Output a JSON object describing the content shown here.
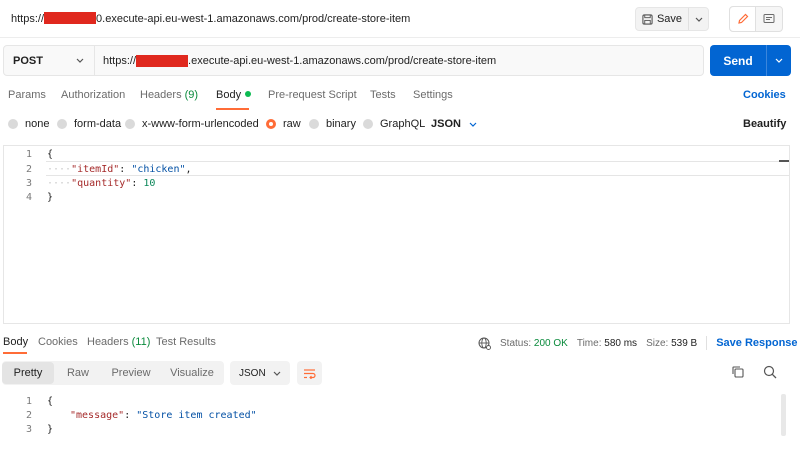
{
  "top": {
    "title_prefix": "https://",
    "title_suffix": "0.execute-api.eu-west-1.amazonaws.com/prod/create-store-item",
    "save_label": "Save"
  },
  "request": {
    "method": "POST",
    "url_prefix": "https://",
    "url_suffix": ".execute-api.eu-west-1.amazonaws.com/prod/create-store-item",
    "send_label": "Send"
  },
  "req_tabs": {
    "params": "Params",
    "authorization": "Authorization",
    "headers": "Headers",
    "headers_count": "(9)",
    "body": "Body",
    "prerequest": "Pre-request Script",
    "tests": "Tests",
    "settings": "Settings",
    "cookies_link": "Cookies"
  },
  "body_types": {
    "none": "none",
    "form_data": "form-data",
    "urlencoded": "x-www-form-urlencoded",
    "raw": "raw",
    "binary": "binary",
    "graphql": "GraphQL",
    "format": "JSON",
    "beautify": "Beautify"
  },
  "request_body": {
    "line_numbers": [
      "1",
      "2",
      "3",
      "4"
    ],
    "open_brace": "{",
    "close_brace": "}",
    "key1": "\"itemId\"",
    "val1": "\"chicken\"",
    "key2": "\"quantity\"",
    "val2": "10"
  },
  "resp_tabs": {
    "body": "Body",
    "cookies": "Cookies",
    "headers": "Headers",
    "headers_count": "(11)",
    "test_results": "Test Results"
  },
  "resp_meta": {
    "status_label": "Status:",
    "status_value": "200 OK",
    "time_label": "Time:",
    "time_value": "580 ms",
    "size_label": "Size:",
    "size_value": "539 B",
    "save_response": "Save Response"
  },
  "resp_toolbar": {
    "pretty": "Pretty",
    "raw": "Raw",
    "preview": "Preview",
    "visualize": "Visualize",
    "format": "JSON"
  },
  "response_body": {
    "line_numbers": [
      "1",
      "2",
      "3"
    ],
    "open_brace": "{",
    "close_brace": "}",
    "key": "\"message\"",
    "value": "\"Store item created\""
  },
  "colors": {
    "accent_orange": "#ff6c37",
    "send_blue": "#0265d2",
    "status_green": "#0a8a3c",
    "redaction_red": "#e0281e"
  }
}
